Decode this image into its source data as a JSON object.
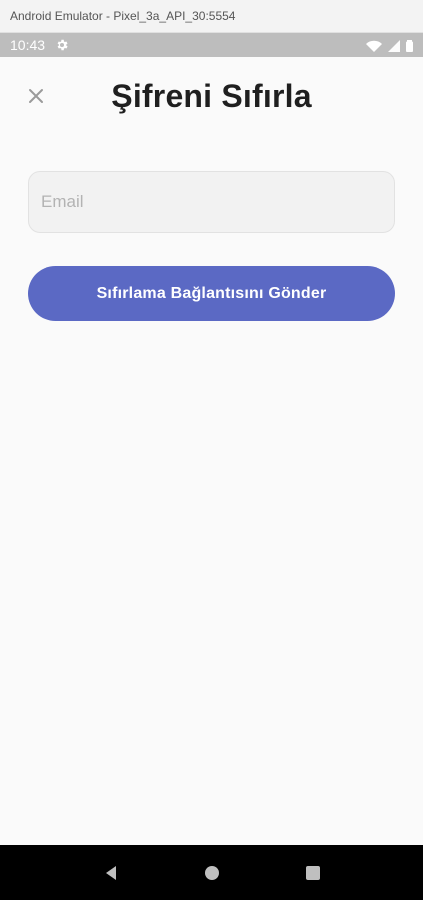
{
  "window": {
    "title": "Android Emulator - Pixel_3a_API_30:5554"
  },
  "status_bar": {
    "time": "10:43",
    "icons": [
      "gear-icon",
      "wifi-icon",
      "signal-icon",
      "battery-icon"
    ]
  },
  "screen": {
    "title": "Şifreni Sıfırla",
    "close_icon": "close-icon",
    "email": {
      "placeholder": "Email",
      "value": ""
    },
    "send_button_label": "Sıfırlama Bağlantısını Gönder"
  },
  "nav_bar": {
    "items": [
      "back-icon",
      "home-icon",
      "recents-icon"
    ]
  },
  "colors": {
    "accent": "#5b69c4",
    "status_bar": "#bdbdbd",
    "background": "#fafafa"
  }
}
